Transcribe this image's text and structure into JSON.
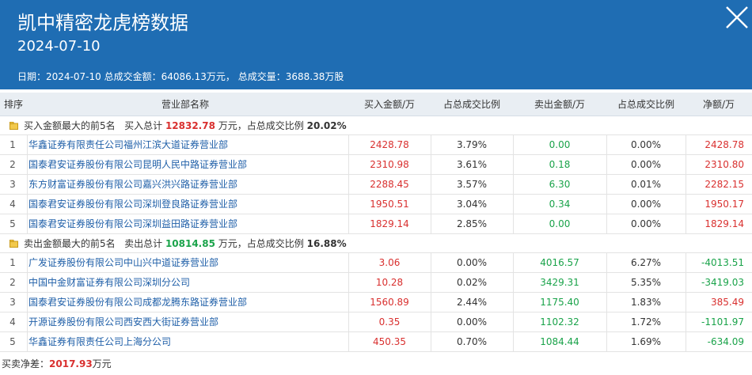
{
  "header": {
    "title": "凯中精密龙虎榜数据",
    "date": "2024-07-10",
    "summary_date_label": "日期：",
    "summary_date": "2024-07-10",
    "summary_amount_label": "总成交金额：",
    "summary_amount": "64086.13万元，",
    "summary_volume_label": "总成交量：",
    "summary_volume": "3688.38万股"
  },
  "columns": [
    "排序",
    "营业部名称",
    "买入金额/万",
    "占总成交比例",
    "卖出金额/万",
    "占总成交比例",
    "净额/万"
  ],
  "buy_group": {
    "label": "买入金额最大的前5名",
    "total_label": "买入总计",
    "total": "12832.78",
    "unit": "万元，占总成交比例",
    "pct": "20.02%"
  },
  "buy_rows": [
    {
      "rank": "1",
      "name": "华鑫证券有限责任公司福州江滨大道证券营业部",
      "buy": "2428.78",
      "buy_pct": "3.79%",
      "sell": "0.00",
      "sell_pct": "0.00%",
      "net": "2428.78"
    },
    {
      "rank": "2",
      "name": "国泰君安证券股份有限公司昆明人民中路证券营业部",
      "buy": "2310.98",
      "buy_pct": "3.61%",
      "sell": "0.18",
      "sell_pct": "0.00%",
      "net": "2310.80"
    },
    {
      "rank": "3",
      "name": "东方财富证券股份有限公司嘉兴洪兴路证券营业部",
      "buy": "2288.45",
      "buy_pct": "3.57%",
      "sell": "6.30",
      "sell_pct": "0.01%",
      "net": "2282.15"
    },
    {
      "rank": "4",
      "name": "国泰君安证券股份有限公司深圳登良路证券营业部",
      "buy": "1950.51",
      "buy_pct": "3.04%",
      "sell": "0.34",
      "sell_pct": "0.00%",
      "net": "1950.17"
    },
    {
      "rank": "5",
      "name": "国泰君安证券股份有限公司深圳益田路证券营业部",
      "buy": "1829.14",
      "buy_pct": "2.85%",
      "sell": "0.00",
      "sell_pct": "0.00%",
      "net": "1829.14"
    }
  ],
  "sell_group": {
    "label": "卖出金额最大的前5名",
    "total_label": "卖出总计",
    "total": "10814.85",
    "unit": "万元，占总成交比例",
    "pct": "16.88%"
  },
  "sell_rows": [
    {
      "rank": "1",
      "name": "广发证券股份有限公司中山兴中道证券营业部",
      "buy": "3.06",
      "buy_pct": "0.00%",
      "sell": "4016.57",
      "sell_pct": "6.27%",
      "net": "-4013.51"
    },
    {
      "rank": "2",
      "name": "中国中金财富证券有限公司深圳分公司",
      "buy": "10.28",
      "buy_pct": "0.02%",
      "sell": "3429.31",
      "sell_pct": "5.35%",
      "net": "-3419.03"
    },
    {
      "rank": "3",
      "name": "国泰君安证券股份有限公司成都龙腾东路证券营业部",
      "buy": "1560.89",
      "buy_pct": "2.44%",
      "sell": "1175.40",
      "sell_pct": "1.83%",
      "net": "385.49"
    },
    {
      "rank": "4",
      "name": "开源证券股份有限公司西安西大街证券营业部",
      "buy": "0.35",
      "buy_pct": "0.00%",
      "sell": "1102.32",
      "sell_pct": "1.72%",
      "net": "-1101.97"
    },
    {
      "rank": "5",
      "name": "华鑫证券有限责任公司上海分公司",
      "buy": "450.35",
      "buy_pct": "0.70%",
      "sell": "1084.44",
      "sell_pct": "1.69%",
      "net": "-634.09"
    }
  ],
  "footer": {
    "label": "买卖净差：",
    "value": "2017.93",
    "unit": "万元"
  },
  "colors": {
    "header_bg": "#1f6db3",
    "positive": "#d9302f",
    "negative": "#1aa34a",
    "link": "#1f5fa8"
  },
  "icons": {
    "close": "close-icon",
    "group": "folder-icon"
  }
}
